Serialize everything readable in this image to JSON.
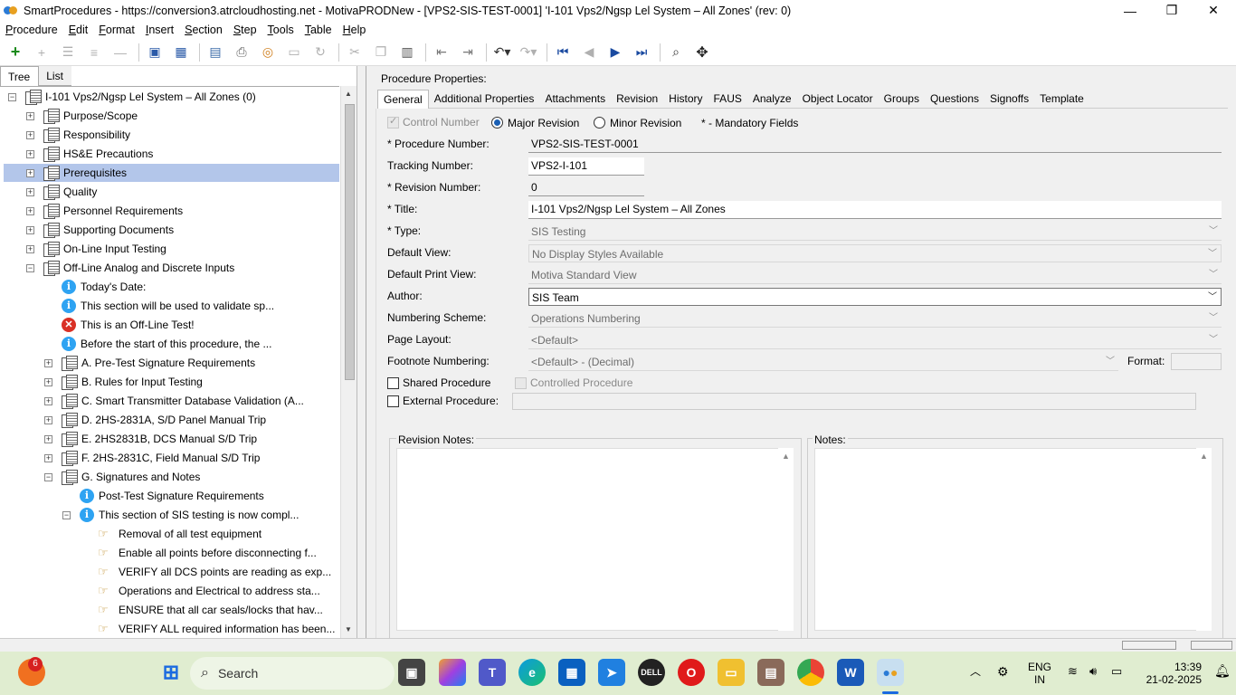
{
  "window": {
    "title": "SmartProcedures - https://conversion3.atrcloudhosting.net - MotivaPRODNew - [VPS2-SIS-TEST-0001] 'I-101 Vps2/Ngsp Lel System – All Zones' (rev: 0)",
    "minimize": "—",
    "maximize": "❐",
    "close": "✕"
  },
  "menu": [
    "Procedure",
    "Edit",
    "Format",
    "Insert",
    "Section",
    "Step",
    "Tools",
    "Table",
    "Help"
  ],
  "left_tabs": [
    "Tree",
    "List"
  ],
  "tree": [
    {
      "label": "I-101 Vps2/Ngsp Lel System – All Zones (0)",
      "level": 0,
      "icon": "doc",
      "exp": "−"
    },
    {
      "label": "Purpose/Scope",
      "level": 1,
      "icon": "doc",
      "exp": "+"
    },
    {
      "label": "Responsibility",
      "level": 1,
      "icon": "doc",
      "exp": "+"
    },
    {
      "label": "HS&E Precautions",
      "level": 1,
      "icon": "doc",
      "exp": "+"
    },
    {
      "label": "Prerequisites",
      "level": 1,
      "icon": "doc",
      "exp": "+",
      "selected": true
    },
    {
      "label": "Quality",
      "level": 1,
      "icon": "doc",
      "exp": "+"
    },
    {
      "label": "Personnel Requirements",
      "level": 1,
      "icon": "doc",
      "exp": "+"
    },
    {
      "label": "Supporting Documents",
      "level": 1,
      "icon": "doc",
      "exp": "+"
    },
    {
      "label": "On-Line Input Testing",
      "level": 1,
      "icon": "doc",
      "exp": "+"
    },
    {
      "label": "Off-Line Analog and Discrete Inputs",
      "level": 1,
      "icon": "doc",
      "exp": "−"
    },
    {
      "label": "Today's Date:",
      "level": 2,
      "icon": "info"
    },
    {
      "label": "This section will be used to validate sp...",
      "level": 2,
      "icon": "info"
    },
    {
      "label": "This is an Off-Line Test!",
      "level": 2,
      "icon": "error"
    },
    {
      "label": "Before the start of this procedure, the ...",
      "level": 2,
      "icon": "info"
    },
    {
      "label": "A. Pre-Test Signature Requirements",
      "level": 2,
      "icon": "doc",
      "exp": "+"
    },
    {
      "label": "B. Rules for Input Testing",
      "level": 2,
      "icon": "doc",
      "exp": "+"
    },
    {
      "label": "C. Smart Transmitter Database Validation (A...",
      "level": 2,
      "icon": "doc",
      "exp": "+"
    },
    {
      "label": "D. 2HS-2831A, S/D Panel Manual Trip",
      "level": 2,
      "icon": "doc",
      "exp": "+"
    },
    {
      "label": "E. 2HS2831B, DCS Manual S/D Trip",
      "level": 2,
      "icon": "doc",
      "exp": "+"
    },
    {
      "label": "F. 2HS-2831C, Field Manual S/D Trip",
      "level": 2,
      "icon": "doc",
      "exp": "+"
    },
    {
      "label": "G. Signatures and Notes",
      "level": 2,
      "icon": "doc",
      "exp": "−"
    },
    {
      "label": "Post-Test Signature Requirements",
      "level": 3,
      "icon": "info"
    },
    {
      "label": "This section of SIS testing is now compl...",
      "level": 3,
      "icon": "info",
      "exp": "−"
    },
    {
      "label": "Removal of all test equipment",
      "level": 4,
      "icon": "hand"
    },
    {
      "label": "Enable all points before disconnecting f...",
      "level": 4,
      "icon": "hand"
    },
    {
      "label": "VERIFY all DCS points are reading as exp...",
      "level": 4,
      "icon": "hand"
    },
    {
      "label": "Operations and Electrical to address sta...",
      "level": 4,
      "icon": "hand"
    },
    {
      "label": "ENSURE that all car seals/locks that hav...",
      "level": 4,
      "icon": "hand"
    },
    {
      "label": "VERIFY ALL required information has been...",
      "level": 4,
      "icon": "hand"
    }
  ],
  "right": {
    "header": "Procedure Properties:",
    "tabs": [
      "General",
      "Additional Properties",
      "Attachments",
      "Revision",
      "History",
      "FAUS",
      "Analyze",
      "Object Locator",
      "Groups",
      "Questions",
      "Signoffs",
      "Template"
    ],
    "control_number": "Control Number",
    "major_revision": "Major Revision",
    "minor_revision": "Minor Revision",
    "mandatory": "* - Mandatory Fields",
    "fields": {
      "procedure_number_label": "* Procedure Number:",
      "procedure_number": "VPS2-SIS-TEST-0001",
      "tracking_number_label": "Tracking Number:",
      "tracking_number": "VPS2-I-101",
      "revision_number_label": "* Revision Number:",
      "revision_number": "0",
      "title_label": "* Title:",
      "title": "I-101 Vps2/Ngsp Lel System – All Zones",
      "type_label": "* Type:",
      "type": "SIS Testing",
      "default_view_label": "Default View:",
      "default_view": "No Display Styles Available",
      "default_print_view_label": "Default Print View:",
      "default_print_view": "Motiva Standard View",
      "author_label": "Author:",
      "author": "SIS Team",
      "numbering_scheme_label": "Numbering Scheme:",
      "numbering_scheme": "Operations Numbering",
      "page_layout_label": "Page Layout:",
      "page_layout": "<Default>",
      "footnote_numbering_label": "Footnote Numbering:",
      "footnote_numbering": "<Default> - (Decimal)",
      "format_label": "Format:",
      "shared_procedure": "Shared Procedure",
      "controlled_procedure": "Controlled Procedure",
      "external_procedure": "External Procedure:"
    },
    "revision_notes": "Revision Notes:",
    "notes": "Notes:"
  },
  "taskbar": {
    "search": "Search",
    "badge": "6",
    "lang1": "ENG",
    "lang2": "IN",
    "time": "13:39",
    "date": "21-02-2025"
  }
}
